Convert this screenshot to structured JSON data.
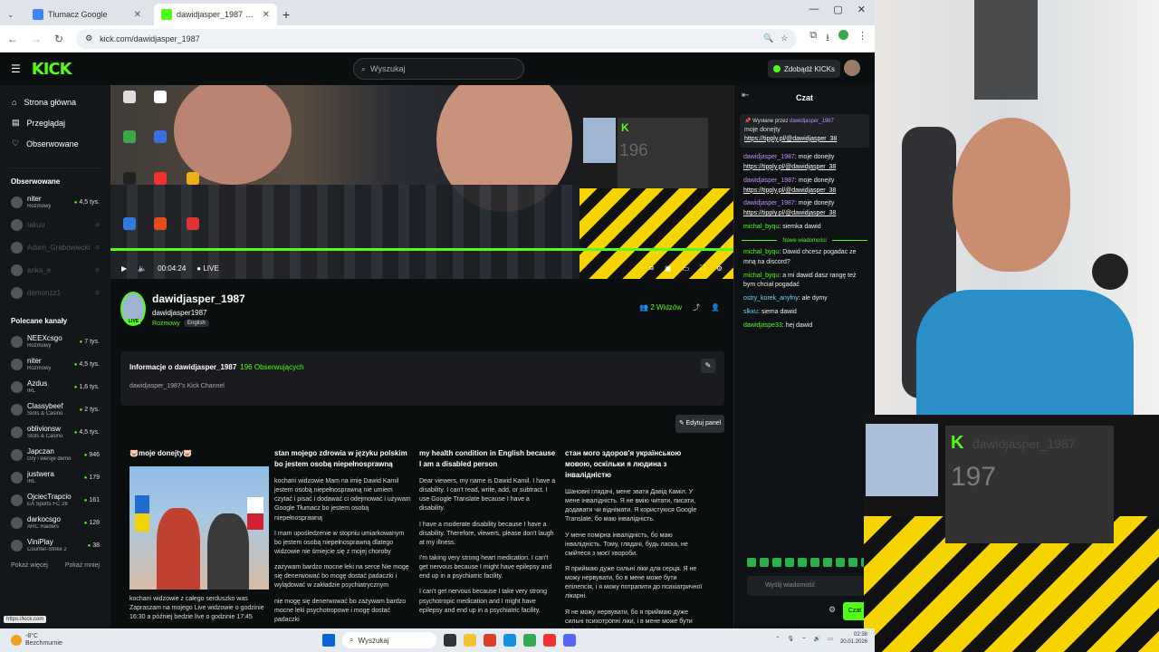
{
  "browser": {
    "tabs": [
      {
        "title": "Tłumacz Google",
        "active": false,
        "favicon_color": "#4285f4"
      },
      {
        "title": "dawidjasper_1987 Stream - Wa",
        "active": true,
        "favicon_color": "#53fc18"
      }
    ],
    "url": "kick.com/dawidjasper_1987"
  },
  "header": {
    "logo": "KICK",
    "search_placeholder": "Wyszukaj",
    "kicks_button": "Zdobądź KICKs"
  },
  "sidebar": {
    "nav": [
      {
        "label": "Strona główna",
        "icon": "home-icon"
      },
      {
        "label": "Przeglądaj",
        "icon": "browse-icon"
      },
      {
        "label": "Obserwowane",
        "icon": "heart-icon"
      }
    ],
    "followed_title": "Obserwowane",
    "followed": [
      {
        "name": "niter",
        "category": "Rozmowy",
        "count": "4,5 tys.",
        "online": true
      },
      {
        "name": "takuu",
        "online": false
      },
      {
        "name": "Adam_Grabowiecki",
        "online": false
      },
      {
        "name": "anka_e",
        "online": false
      },
      {
        "name": "demonzz1",
        "online": false
      }
    ],
    "recommended_title": "Polecane kanały",
    "recommended": [
      {
        "name": "NEEXcsgo",
        "category": "Rozmowy",
        "count": "7 tys."
      },
      {
        "name": "niter",
        "category": "Rozmowy",
        "count": "4,5 tys."
      },
      {
        "name": "Azdus",
        "category": "IRL",
        "count": "1,6 tys."
      },
      {
        "name": "Classybeef",
        "category": "Slots & Casino",
        "count": "2 tys."
      },
      {
        "name": "oblivionsw",
        "category": "Slots & Casino",
        "count": "4,5 tys."
      },
      {
        "name": "Japczan",
        "category": "Gry i wersje demo",
        "count": "946"
      },
      {
        "name": "justwera",
        "category": "IRL",
        "count": "179"
      },
      {
        "name": "OjciecTrapcio",
        "category": "EA Sports FC 26",
        "count": "161"
      },
      {
        "name": "darkocsgo",
        "category": "ARC Raiders",
        "count": "128"
      },
      {
        "name": "ViniPlay",
        "category": "Counter-Strike 2",
        "count": "38"
      }
    ],
    "show_more": "Pokaż więcej",
    "show_less": "Pokaż mniej"
  },
  "player": {
    "time": "00:04:24",
    "live_label": "LIVE",
    "overlay_count": "196"
  },
  "channel": {
    "display_name": "dawidjasper_1987",
    "username": "dawidjasper1987",
    "category": "Rozmowy",
    "tag": "English",
    "live_badge": "LIVE",
    "viewers": "2 Widzów",
    "about_title": "Informacje o dawidjasper_1987",
    "followers": "196 Obserwujących",
    "about_desc": "dawidjasper_1987's Kick Channel",
    "edit_panel": "Edytuj panel"
  },
  "panels": [
    {
      "title": "🐷moje donejty🐷",
      "paragraphs": [
        "kochani widzowie z całego serduszko was Zapraszam na mojego Live widzowie o godzinie 16:30 a później bedzie live o godzinie 17:45"
      ]
    },
    {
      "title": "stan mojego zdrowia w języku polskim bo jestem osobą niepełnosprawną",
      "paragraphs": [
        "kochani widzowie Mam na imię Dawid Kamil jestem osobą niepełnosprawną nie umiem czytać i pisać i dodawać ci odejmować i używam Google Tłumacz bo jestem osobą niepełnosprawną",
        "I mam upośledzenie w stopniu umiarkowanym bo jestem osobą niepełnosprawną dlatego widzowie nie śmiejcie się z mojej choroby",
        "zażywam bardzo mocne leki na serce Nie mogę się denerwować bo mogę dostać padaczki i wylądować w zakładzie psychiatrycznym",
        "nie mogę się denerwować bo zażywam bardzo mocne leki psychotropowe i mogę dostać padaczki"
      ]
    },
    {
      "title": "my health condition in English because I am a disabled person",
      "paragraphs": [
        "Dear viewers, my name is Dawid Kamil. I have a disability. I can't read, write, add, or subtract. I use Google Translate because I have a disability.",
        "I have a moderate disability because I have a disability. Therefore, viewers, please don't laugh at my illness.",
        "I'm taking very strong heart medication. I can't get nervous because I might have epilepsy and end up in a psychiatric facility.",
        "I can't get nervous because I take very strong psychotropic medication and I might have epilepsy and end up in a psychiatric facility."
      ]
    },
    {
      "title": "стан мого здоров'я українською мовою, оскільки я людина з інвалідністю",
      "paragraphs": [
        "Шановні глядачі, мене звати Давід Каміл. У мене інвалідність. Я не вмію читати, писати, додавати чи віднімати. Я користуюся Google Translate, бо маю інвалідність.",
        "У мене помірна інвалідність, бо маю інвалідність. Тому, глядачі, будь ласка, не смійтеся з моєї хвороби.",
        "Я приймаю дуже сильні ліки для серця. Я не можу нервувати, бо в мене може бути епілепсія, і я можу потрапити до психіатричної лікарні.",
        "Я не можу нервувати, бо я приймаю дуже сильні психотропні ліки, і в мене може бути епілепсія, і"
      ]
    }
  ],
  "chat": {
    "title": "Czat",
    "pinned": {
      "by_label": "Wysłane przez",
      "by_user": "dawidjasper_1987",
      "text": "moje donejty",
      "link": "https://tipply.pl/@dawidjasper_38"
    },
    "messages": [
      {
        "user": "dawidjasper_1987",
        "text": ": moje donejty",
        "link": "https://tipply.pl/@dawidjasper_38",
        "color": "u1"
      },
      {
        "user": "dawidjasper_1987",
        "text": ": moje donejty",
        "link": "https://tipply.pl/@dawidjasper_38",
        "color": "u1"
      },
      {
        "user": "dawidjasper_1987",
        "text": ": moje donejty",
        "link": "https://tipply.pl/@dawidjasper_38",
        "color": "u1"
      },
      {
        "user": "michal_byqu",
        "text": ": siemka dawid",
        "link": "",
        "color": "u2"
      }
    ],
    "new_messages": "Nowe wiadomości",
    "new": [
      {
        "user": "michal_byqu",
        "text": ": Dawid chcesz pogadac ze mną na discord?",
        "color": "u2"
      },
      {
        "user": "michal_byqu",
        "text": ": a mi dawid dasz rangę też bym chciał pogadać",
        "color": "u2"
      },
      {
        "user": "ostry_korek_anyfny",
        "text": ": ale dymy",
        "color": "u3"
      },
      {
        "user": "slkxu",
        "text": ": siema dawid",
        "color": "u3"
      },
      {
        "user": "dawidjaspe33",
        "text": ": hej dawid",
        "color": "u4"
      }
    ],
    "input_placeholder": "Wyślij wiadomość",
    "send": "Czat"
  },
  "overlay": {
    "count": "197",
    "username": "dawidjasper_1987"
  },
  "statusbar": {
    "link": "https://kick.com"
  },
  "taskbar": {
    "temp": "-8°C",
    "weather": "Bezchmurnie",
    "search": "Wyszukaj",
    "time": "02:38",
    "date": "20.01.2026"
  }
}
